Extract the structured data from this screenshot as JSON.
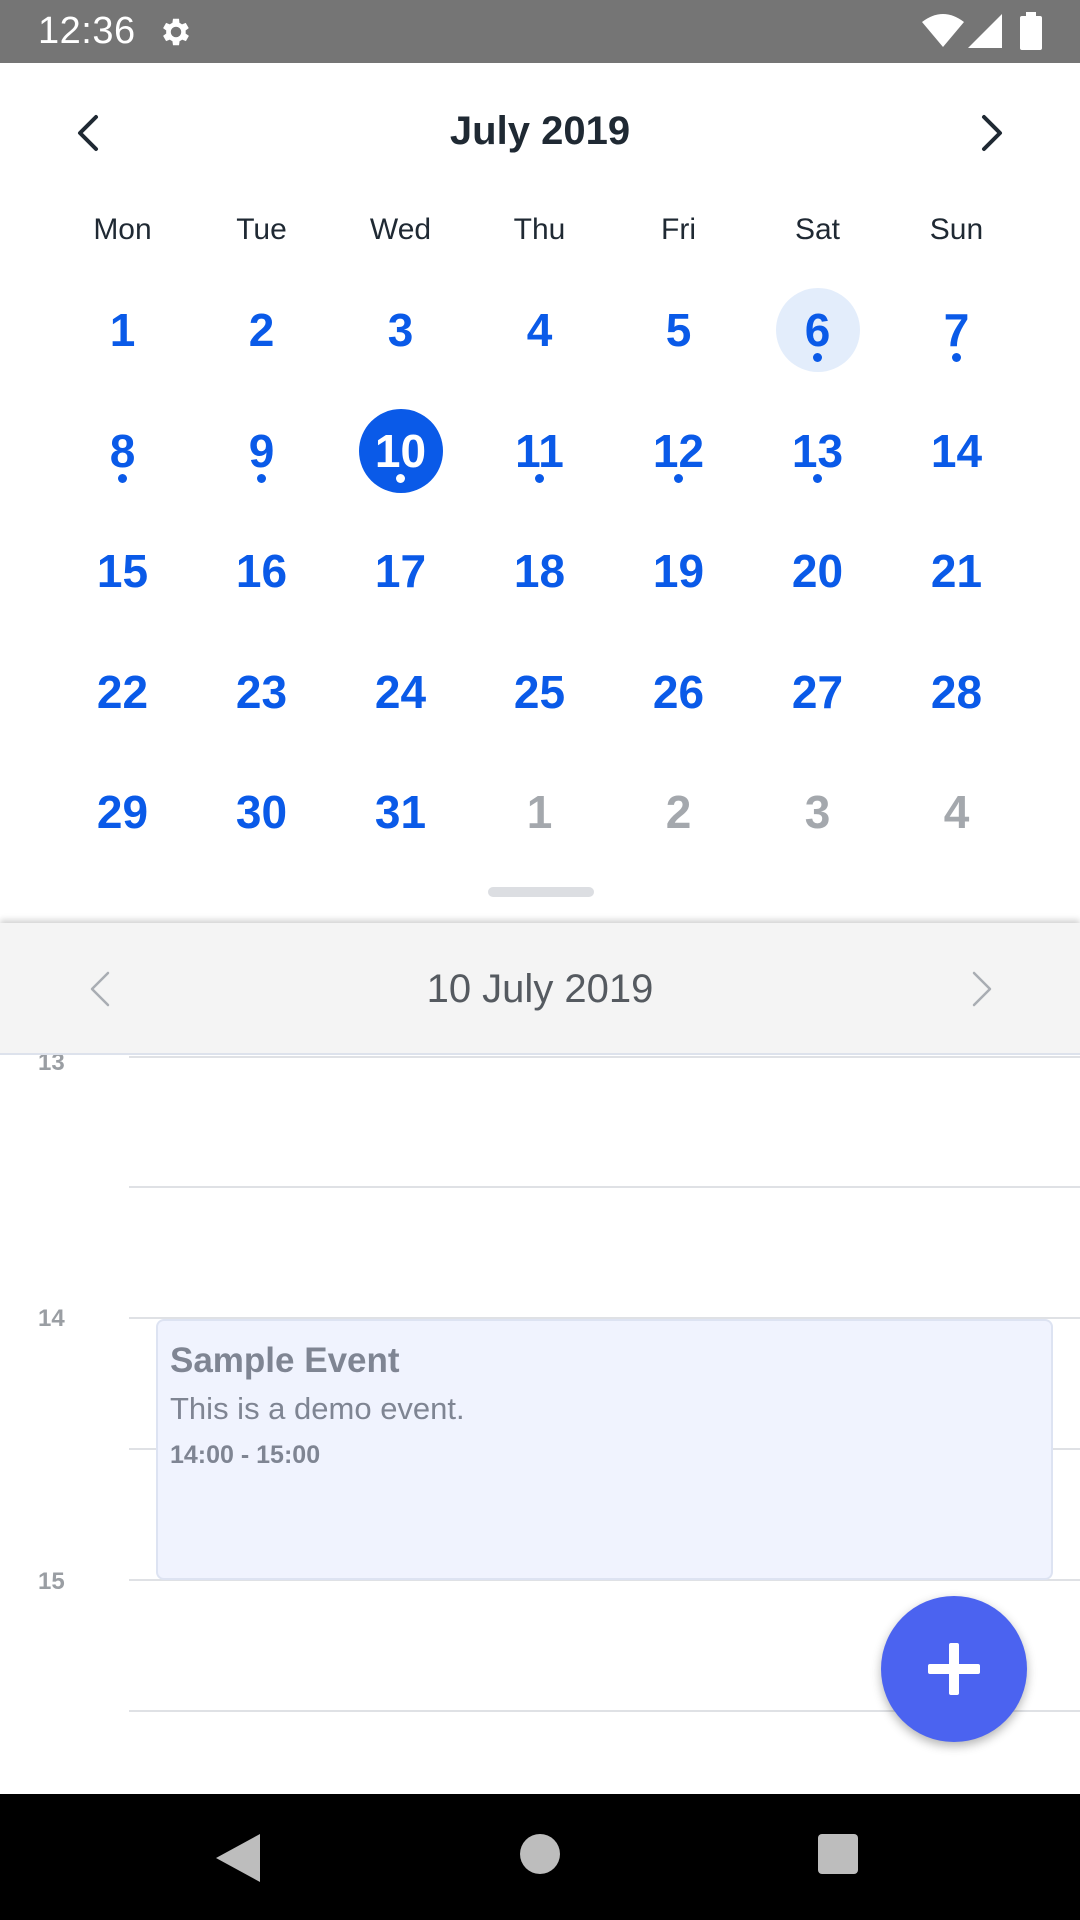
{
  "status_bar": {
    "time": "12:36",
    "icons": [
      "gear-icon",
      "wifi-icon",
      "cell-signal-icon",
      "battery-icon"
    ],
    "background": "#757575"
  },
  "calendar": {
    "month_title": "July 2019",
    "weekdays": [
      "Mon",
      "Tue",
      "Wed",
      "Thu",
      "Fri",
      "Sat",
      "Sun"
    ],
    "accent_color": "#0a5ae8",
    "days": [
      {
        "label": "1",
        "other": false,
        "dot": false
      },
      {
        "label": "2",
        "other": false,
        "dot": false
      },
      {
        "label": "3",
        "other": false,
        "dot": false
      },
      {
        "label": "4",
        "other": false,
        "dot": false
      },
      {
        "label": "5",
        "other": false,
        "dot": false
      },
      {
        "label": "6",
        "other": false,
        "dot": true,
        "today": true
      },
      {
        "label": "7",
        "other": false,
        "dot": true
      },
      {
        "label": "8",
        "other": false,
        "dot": true
      },
      {
        "label": "9",
        "other": false,
        "dot": true
      },
      {
        "label": "10",
        "other": false,
        "dot": true,
        "selected": true
      },
      {
        "label": "11",
        "other": false,
        "dot": true
      },
      {
        "label": "12",
        "other": false,
        "dot": true
      },
      {
        "label": "13",
        "other": false,
        "dot": true
      },
      {
        "label": "14",
        "other": false,
        "dot": false
      },
      {
        "label": "15",
        "other": false,
        "dot": false
      },
      {
        "label": "16",
        "other": false,
        "dot": false
      },
      {
        "label": "17",
        "other": false,
        "dot": false
      },
      {
        "label": "18",
        "other": false,
        "dot": false
      },
      {
        "label": "19",
        "other": false,
        "dot": false
      },
      {
        "label": "20",
        "other": false,
        "dot": false
      },
      {
        "label": "21",
        "other": false,
        "dot": false
      },
      {
        "label": "22",
        "other": false,
        "dot": false
      },
      {
        "label": "23",
        "other": false,
        "dot": false
      },
      {
        "label": "24",
        "other": false,
        "dot": false
      },
      {
        "label": "25",
        "other": false,
        "dot": false
      },
      {
        "label": "26",
        "other": false,
        "dot": false
      },
      {
        "label": "27",
        "other": false,
        "dot": false
      },
      {
        "label": "28",
        "other": false,
        "dot": false
      },
      {
        "label": "29",
        "other": false,
        "dot": false
      },
      {
        "label": "30",
        "other": false,
        "dot": false
      },
      {
        "label": "31",
        "other": false,
        "dot": false
      },
      {
        "label": "1",
        "other": true,
        "dot": false
      },
      {
        "label": "2",
        "other": true,
        "dot": false
      },
      {
        "label": "3",
        "other": true,
        "dot": false
      },
      {
        "label": "4",
        "other": true,
        "dot": false
      }
    ]
  },
  "day_view": {
    "title": "10 July 2019",
    "hour_labels": [
      "13",
      "14",
      "15"
    ],
    "event": {
      "title": "Sample Event",
      "description": "This is a demo event.",
      "time": "14:00 - 15:00",
      "background": "#f0f3fe"
    },
    "fab_color": "#4b63f0"
  },
  "nav_bar": {
    "icons": [
      "back-icon",
      "home-icon",
      "recents-icon"
    ]
  }
}
